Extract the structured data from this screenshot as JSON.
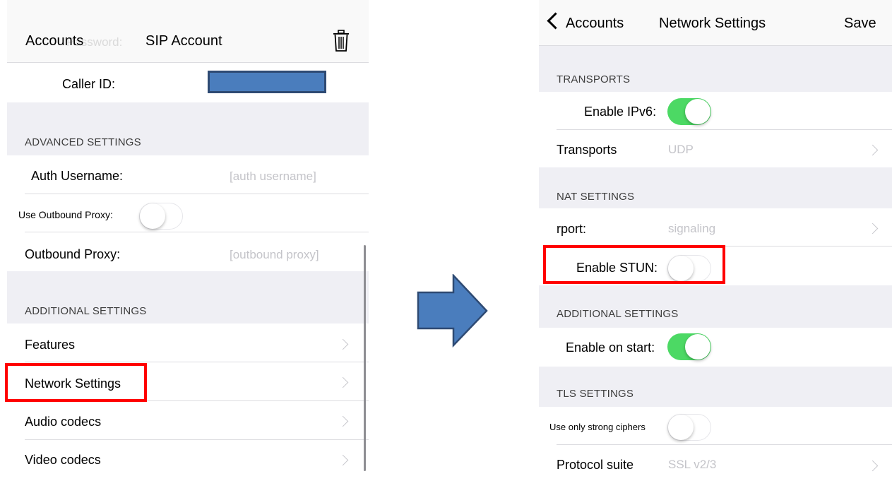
{
  "left": {
    "nav": {
      "back_label": "Accounts",
      "title": "SIP Account",
      "password_ghost": "Password:",
      "trash_icon": "trash-icon"
    },
    "caller_id": {
      "label": "Caller ID:",
      "value_redacted": true,
      "redaction_color": "#4a7dbd"
    },
    "advanced": {
      "header": "ADVANCED SETTINGS",
      "auth_username": {
        "label": "Auth Username:",
        "placeholder": "[auth username]"
      },
      "outbound_proxy_toggle": {
        "label": "Use Outbound Proxy:",
        "on": false
      },
      "outbound_proxy": {
        "label": "Outbound Proxy:",
        "placeholder": "[outbound proxy]"
      }
    },
    "additional": {
      "header": "ADDITIONAL SETTINGS",
      "items": [
        {
          "label": "Features"
        },
        {
          "label": "Network Settings",
          "highlighted": true
        },
        {
          "label": "Audio codecs"
        },
        {
          "label": "Video codecs"
        }
      ]
    }
  },
  "arrow": {
    "color": "#4a7dbd",
    "direction": "right"
  },
  "right": {
    "nav": {
      "back_label": "Accounts",
      "title": "Network Settings",
      "save_label": "Save"
    },
    "transports": {
      "header": "TRANSPORTS",
      "enable_ipv6": {
        "label": "Enable IPv6:",
        "on": true
      },
      "transports": {
        "label": "Transports",
        "value": "UDP"
      }
    },
    "nat": {
      "header": "NAT SETTINGS",
      "rport": {
        "label": "rport:",
        "value": "signaling"
      },
      "enable_stun": {
        "label": "Enable STUN:",
        "on": false,
        "highlighted": true
      }
    },
    "additional": {
      "header": "ADDITIONAL SETTINGS",
      "enable_on_start": {
        "label": "Enable on start:",
        "on": true
      }
    },
    "tls": {
      "header": "TLS SETTINGS",
      "strong_ciphers": {
        "label": "Use only strong ciphers",
        "on": false
      },
      "protocol_suite": {
        "label": "Protocol suite",
        "value": "SSL v2/3"
      }
    }
  },
  "colors": {
    "highlight": "#ff0000",
    "switch_on": "#4cd964",
    "group_bg": "#efeff4"
  }
}
